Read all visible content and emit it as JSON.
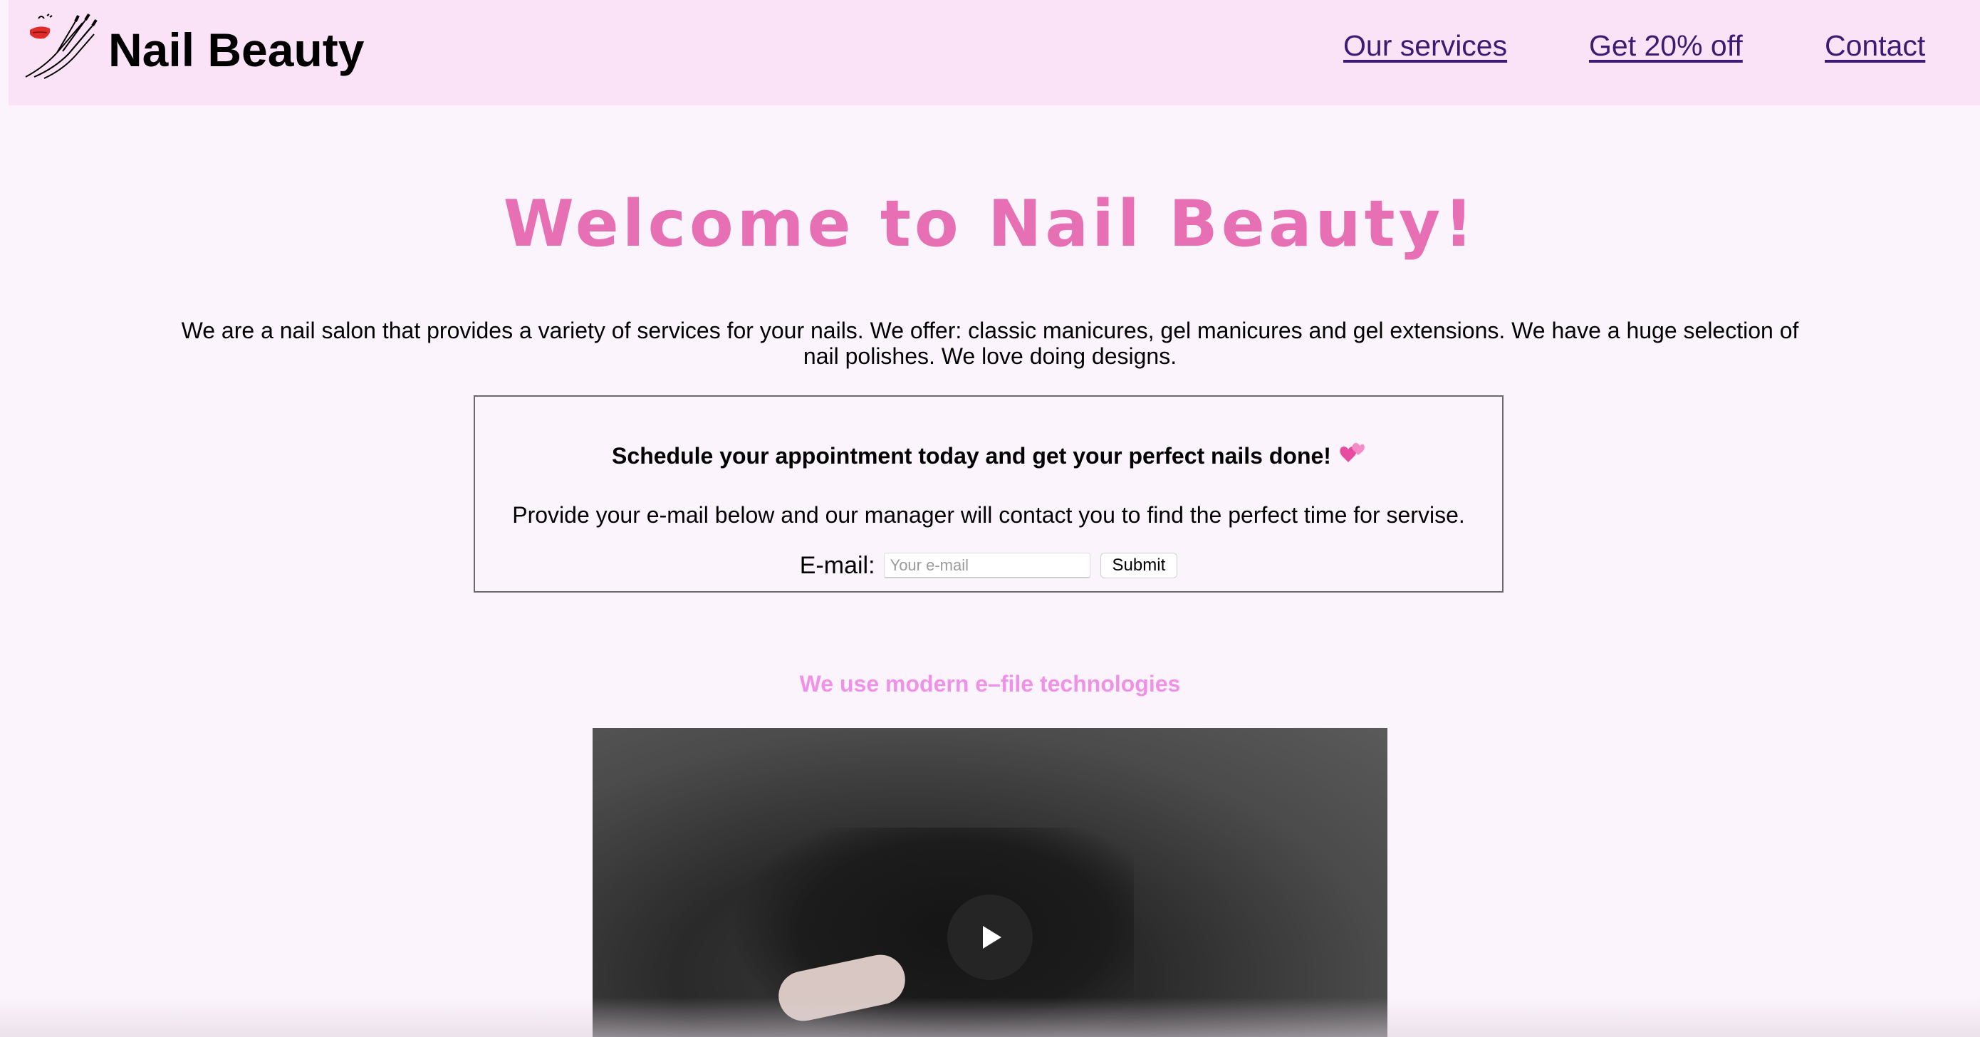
{
  "header": {
    "brand": "Nail Beauty",
    "logo_icon": "hand-with-lips-icon",
    "nav": [
      {
        "label": "Our services"
      },
      {
        "label": "Get 20% off"
      },
      {
        "label": "Contact"
      }
    ]
  },
  "hero": {
    "title": "Welcome to Nail Beauty!",
    "intro": "We are a nail salon that provides a variety of services for your nails. We offer: classic manicures, gel manicures and gel extensions. We have a huge selection of nail polishes. We love doing designs."
  },
  "appointment": {
    "heading": "Schedule your appointment today and get your perfect nails done!",
    "heading_icon": "two-hearts-icon",
    "subtext": "Provide your e-mail below and our manager will contact you to find the perfect time for servise.",
    "email_label": "E-mail:",
    "email_placeholder": "Your e-mail",
    "email_value": "",
    "submit_label": "Submit"
  },
  "efile": {
    "heading": "We use modern e–file technologies"
  },
  "video": {
    "play_icon": "play-icon"
  },
  "colors": {
    "page_bg": "#fcf4fc",
    "header_bg": "#fae3f6",
    "title_pink": "#e76fb4",
    "efile_pink": "#ee92e8",
    "nav_link": "#3d1a73"
  }
}
